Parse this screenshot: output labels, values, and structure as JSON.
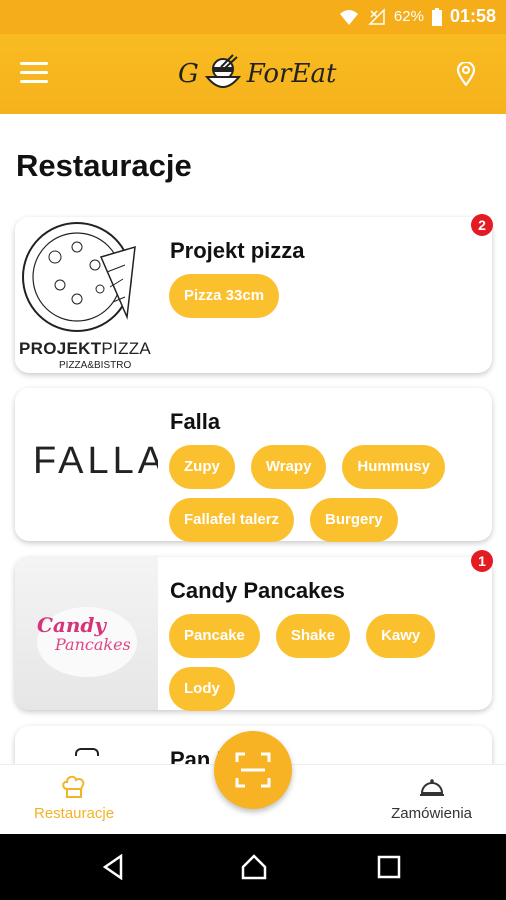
{
  "status_bar": {
    "battery": "62%",
    "time": "01:58"
  },
  "app_bar": {
    "logo_left": "G",
    "logo_right": "ForEat"
  },
  "page": {
    "title": "Restauracje"
  },
  "restaurants": [
    {
      "name": "Projekt pizza",
      "badge": "2",
      "tags": [
        "Pizza 33cm"
      ],
      "logo": {
        "bold": "PROJEKT",
        "light": "PIZZA",
        "sub": "PIZZA&BISTRO"
      }
    },
    {
      "name": "Falla",
      "badge": null,
      "tags": [
        "Zupy",
        "Wrapy",
        "Hummusy",
        "Fallafel talerz",
        "Burgery"
      ],
      "logo": {
        "text": "FALLA"
      }
    },
    {
      "name": "Candy Pancakes",
      "badge": "1",
      "tags": [
        "Pancake",
        "Shake",
        "Kawy",
        "Lody"
      ],
      "logo": {
        "line1": "Candy",
        "line2": "Pancakes"
      }
    },
    {
      "name": "Pan Ramen",
      "badge": null,
      "tags": []
    }
  ],
  "bottom_nav": {
    "restaurants": "Restauracje",
    "orders": "Zamówienia"
  },
  "colors": {
    "brand": "#f6b21c",
    "tag": "#fbc02d",
    "badge": "#e31b23"
  },
  "icons": [
    "menu-icon",
    "location-pin-icon",
    "scan-icon",
    "chef-hat-icon",
    "cloche-icon",
    "back-icon",
    "home-icon",
    "recents-icon"
  ]
}
